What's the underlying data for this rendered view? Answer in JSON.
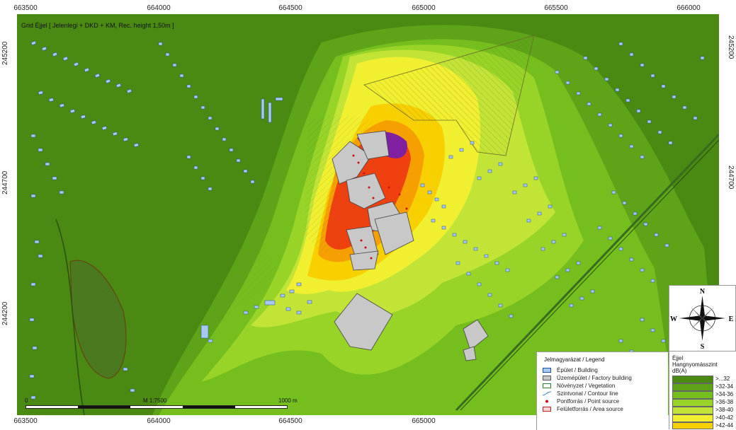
{
  "map": {
    "caption": "Grid Éjjel  [ Jelenlegi + DKD + KM, Rec. height  1,50m ]",
    "coords_top": [
      "663500",
      "664000",
      "664500",
      "665000",
      "665500",
      "666000"
    ],
    "coords_bottom": [
      "663500",
      "664000",
      "664500",
      "665000",
      "665500",
      "666000"
    ],
    "coords_left": [
      "245200",
      "244700",
      "244200"
    ],
    "coords_right": [
      "245200",
      "244700"
    ],
    "scale_start": "0",
    "scale_ratio": "M 1:7500",
    "scale_end": "1000 m"
  },
  "legend": {
    "title": "Jelmagyarázat / Legend",
    "items": [
      {
        "label": "Épület / Building",
        "icon": "building-symbol",
        "fill": "#a8c8f0",
        "stroke": "#2050a0"
      },
      {
        "label": "Üzemépület / Factory building",
        "icon": "factory-symbol",
        "fill": "#c8c8c8",
        "stroke": "#555555"
      },
      {
        "label": "Növényzet / Vegetation",
        "icon": "vegetation-symbol",
        "fill": "#ffffff",
        "stroke": "#2a8a2a"
      },
      {
        "label": "Szintvonal / Contour line",
        "icon": "contour-symbol",
        "fill": "none",
        "stroke": "#4080c0"
      },
      {
        "label": "Pontforrás / Point source",
        "icon": "point-source-symbol",
        "fill": "#d01010",
        "stroke": "#d01010"
      },
      {
        "label": "Felületforrás / Area source",
        "icon": "area-source-symbol",
        "fill": "#f8d8d8",
        "stroke": "#c02020"
      }
    ]
  },
  "compass": {
    "n": "N",
    "s": "S",
    "e": "E",
    "w": "W"
  },
  "noise_legend": {
    "title1": "Éjjel",
    "title2": "Hangnyomásszint",
    "unit": "dB(A)",
    "classes": [
      {
        "label": ">...32",
        "color": "#4a8a12"
      },
      {
        "label": ">32-34",
        "color": "#5ea418"
      },
      {
        "label": ">34-36",
        "color": "#74be1e"
      },
      {
        "label": ">36-38",
        "color": "#98d428"
      },
      {
        "label": ">38-40",
        "color": "#c2e436"
      },
      {
        "label": ">40-42",
        "color": "#f0f030"
      },
      {
        "label": ">42-44",
        "color": "#f8d000"
      }
    ]
  }
}
